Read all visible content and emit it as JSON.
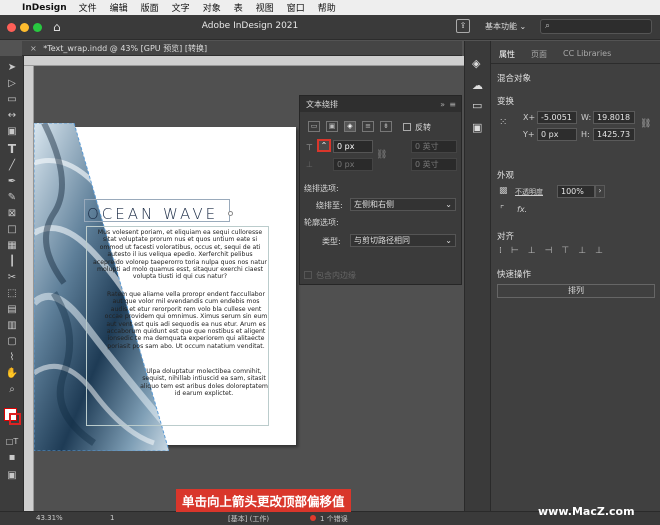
{
  "menubar": {
    "apple_icon": "apple-logo",
    "app_name": "InDesign",
    "items": [
      "文件",
      "编辑",
      "版面",
      "文字",
      "对象",
      "表",
      "视图",
      "窗口",
      "帮助"
    ]
  },
  "titlebar": {
    "title": "Adobe InDesign 2021",
    "workspace": "基本功能"
  },
  "document_tab": {
    "label": "*Text_wrap.indd @ 43% [GPU 预览] [转换]"
  },
  "document": {
    "heading": "OCEAN WAVE",
    "paragraphs": [
      "Mus volesent poriam, et eliquiam ea sequi culloresse sitat voluptate prorum nus et quos untium eate si ommod ut facesti voloratibus, occus et, sequi de ati autesto il ius veliqua epedio. Xerferchit pelibus acepreido volorep taeperorro toria nulpa quos nos natur molupti ad molo quamus esst, sitaquur exerchi ciaest volupta tiusti id qui cus natur?",
      "Ratem que aliame vella proropr endent faccullabor aut que volor mil evendandis cum endebis mos audis et etur rerorporit rem volo bla cullese vent occae providem qui omnimus. Ximus serum sin eum aut vent est quis adi sequodis ea nus etur. Arum es accaborum quidunt est que que nostibus et aligent ionsedic te ma demquata experiorem qui alitaecte poriasit pos sam abo. Ut occum natatium venditat.",
      "Ulpa doluptatur molectibea comnihit, sequist, nihillab intiuscid ea sam, sitasit aliquo tem est aribus doles doloreptatem id earum explictet."
    ]
  },
  "text_wrap_panel": {
    "title": "文本绕排",
    "invert_label": "反转",
    "top_offset": "0 px",
    "bottom_offset": "0 px",
    "left_offset": "0 英寸",
    "right_offset": "0 英寸",
    "wrap_options_title": "绕排选项:",
    "wrap_to_label": "绕排至:",
    "wrap_to_value": "左侧和右侧",
    "contour_title": "轮廓选项:",
    "type_label": "类型:",
    "type_value": "与剪切路径相同",
    "include_inside_edges": "包含内边缘"
  },
  "properties_panel": {
    "tabs": [
      "属性",
      "页面",
      "CC Libraries"
    ],
    "section_mixed": "混合对象",
    "section_transform": "变换",
    "x_label": "X+",
    "x_value": "-5.0051",
    "y_label": "Y+",
    "y_value": "0 px",
    "w_label": "W:",
    "w_value": "19.8018",
    "h_label": "H:",
    "h_value": "1425.73",
    "section_appearance": "外观",
    "opacity_label": "不透明度",
    "opacity_value": "100%",
    "fx_label": "fx.",
    "section_align": "对齐",
    "section_quick": "快速操作",
    "arrange_button": "排列"
  },
  "statusbar": {
    "zoom": "43.31%",
    "page": "1",
    "style": "[基本] (工作)",
    "errors": "1 个错误"
  },
  "caption": "单击向上箭头更改顶部偏移值",
  "watermark": "www.MacZ.com",
  "colors": {
    "highlight_red": "#d9362b",
    "heading_navy": "#1a2a44",
    "panel_bg": "#3b3b3b"
  }
}
